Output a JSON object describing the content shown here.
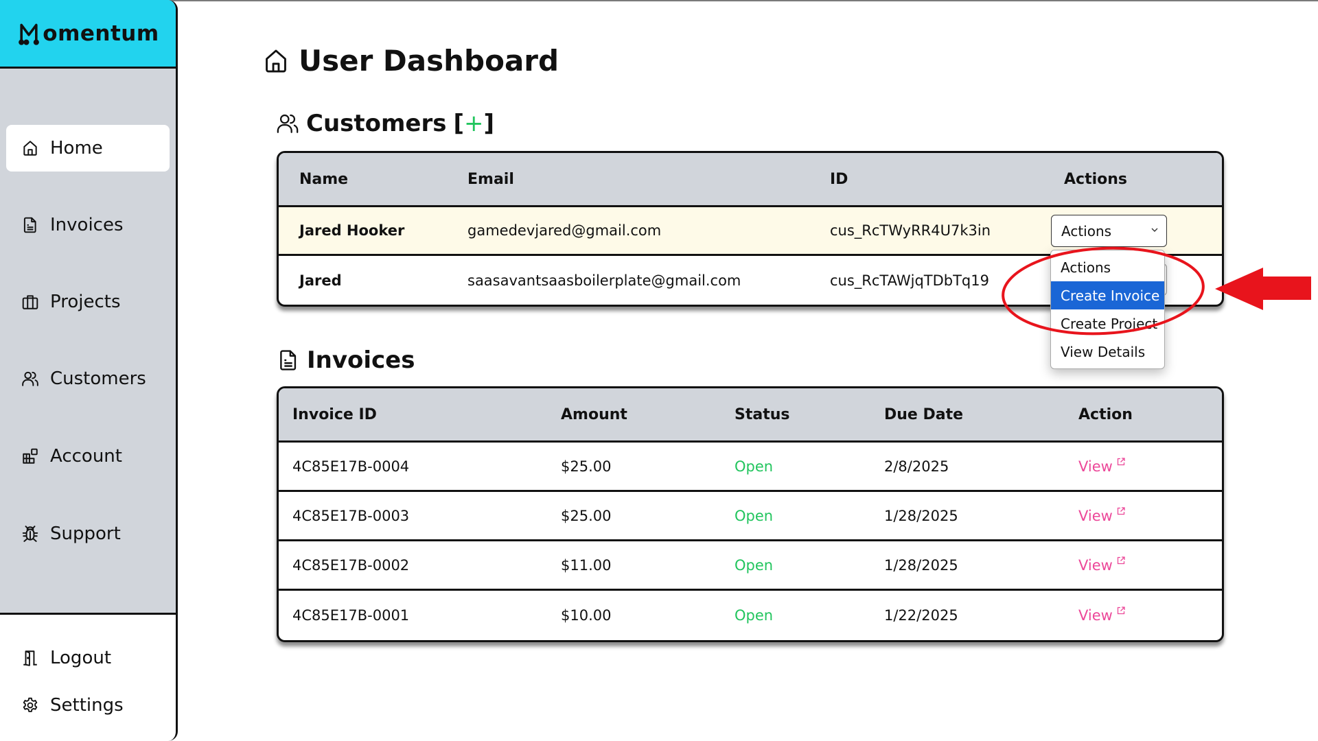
{
  "app": {
    "brand": "Momentum",
    "brand_rest": "omentum"
  },
  "sidebar": {
    "items": [
      {
        "label": "Home",
        "icon": "home-icon",
        "active": true
      },
      {
        "label": "Invoices",
        "icon": "document-icon"
      },
      {
        "label": "Projects",
        "icon": "briefcase-icon"
      },
      {
        "label": "Customers",
        "icon": "users-icon"
      },
      {
        "label": "Account",
        "icon": "grid-icon"
      },
      {
        "label": "Support",
        "icon": "bug-icon"
      }
    ],
    "bottom_items": [
      {
        "label": "Logout",
        "icon": "door-icon"
      },
      {
        "label": "Settings",
        "icon": "gear-icon"
      }
    ]
  },
  "page": {
    "title": "User Dashboard",
    "customers_heading": "Customers",
    "add_open": "[",
    "add_plus": "+",
    "add_close": "]",
    "invoices_heading": "Invoices"
  },
  "customers": {
    "columns": [
      "Name",
      "Email",
      "ID",
      "Actions"
    ],
    "rows": [
      {
        "name": "Jared Hooker",
        "email": "gamedevjared@gmail.com",
        "id": "cus_RcTWyRR4U7k3in",
        "action": "Actions"
      },
      {
        "name": "Jared",
        "email": "saasavantsaasboilerplate@gmail.com",
        "id": "cus_RcTAWjqTDbTq19",
        "action": "Actions"
      }
    ]
  },
  "actions_menu": {
    "options": [
      "Actions",
      "Create Invoice",
      "Create Project",
      "View Details"
    ],
    "highlighted": "Create Invoice"
  },
  "invoices": {
    "columns": [
      "Invoice ID",
      "Amount",
      "Status",
      "Due Date",
      "Action"
    ],
    "rows": [
      {
        "id": "4C85E17B-0004",
        "amount": "$25.00",
        "status": "Open",
        "due": "2/8/2025",
        "action": "View"
      },
      {
        "id": "4C85E17B-0003",
        "amount": "$25.00",
        "status": "Open",
        "due": "1/28/2025",
        "action": "View"
      },
      {
        "id": "4C85E17B-0002",
        "amount": "$11.00",
        "status": "Open",
        "due": "1/28/2025",
        "action": "View"
      },
      {
        "id": "4C85E17B-0001",
        "amount": "$10.00",
        "status": "Open",
        "due": "1/22/2025",
        "action": "View"
      }
    ]
  },
  "colors": {
    "brand": "#22d3ee",
    "sidebar_bg": "#d1d5db",
    "status_open": "#22c55e",
    "link": "#ec4899",
    "menu_highlight": "#1a66d6",
    "annotation": "#e8141c"
  }
}
